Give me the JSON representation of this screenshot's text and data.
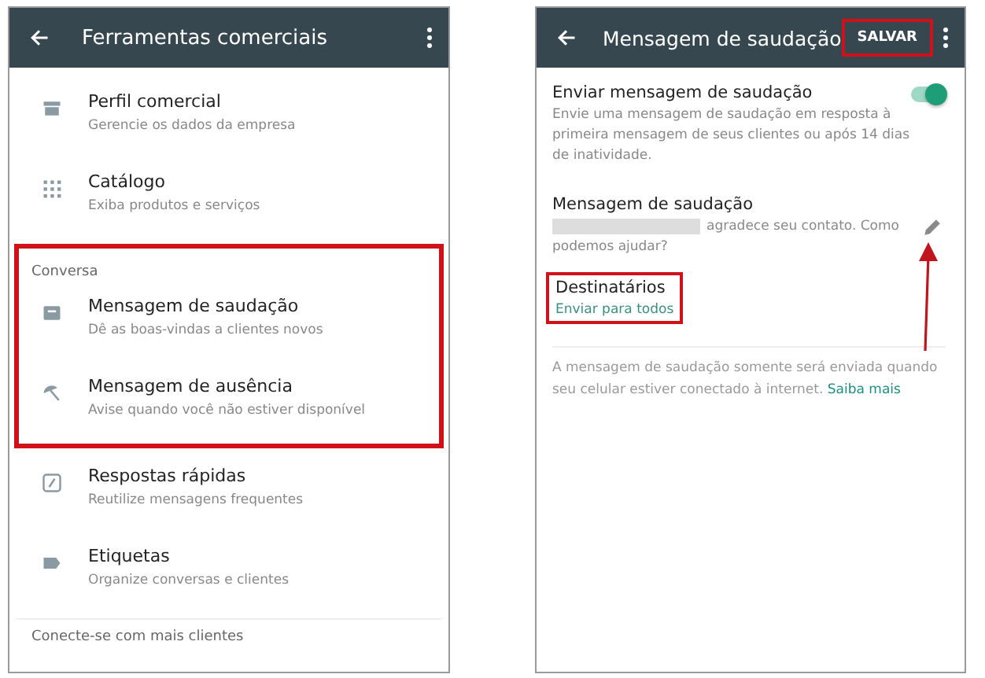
{
  "left_screen": {
    "title": "Ferramentas comerciais",
    "groups": [
      {
        "items": [
          {
            "title": "Perfil comercial",
            "subtitle": "Gerencie os dados da empresa"
          },
          {
            "title": "Catálogo",
            "subtitle": "Exiba produtos e serviços"
          }
        ]
      },
      {
        "header": "Conversa",
        "highlighted": true,
        "items": [
          {
            "title": "Mensagem de saudação",
            "subtitle": "Dê as boas-vindas a clientes novos"
          },
          {
            "title": "Mensagem de ausência",
            "subtitle": "Avise quando você não estiver disponível"
          }
        ]
      },
      {
        "items": [
          {
            "title": "Respostas rápidas",
            "subtitle": "Reutilize mensagens frequentes"
          },
          {
            "title": "Etiquetas",
            "subtitle": "Organize conversas e clientes"
          }
        ]
      },
      {
        "header": "Conecte-se com mais clientes"
      }
    ]
  },
  "right_screen": {
    "title": "Mensagem de saudação",
    "save_button": {
      "label": "SALVAR",
      "highlighted": true
    },
    "send_toggle": {
      "title": "Enviar mensagem de saudação",
      "description": "Envie uma mensagem de saudação em resposta à primeira mensagem de seus clientes ou após 14 dias de inatividade.",
      "on": true
    },
    "greeting": {
      "title": "Mensagem de saudação",
      "redacted": true,
      "text": "agradece seu contato. Como podemos ajudar?",
      "arrow": true
    },
    "recipients": {
      "title": "Destinatários",
      "value": "Enviar para todos",
      "highlighted": true
    },
    "note": {
      "text": "A mensagem de saudação somente será enviada quando seu celular estiver conectado à internet.",
      "link": "Saiba mais"
    }
  }
}
